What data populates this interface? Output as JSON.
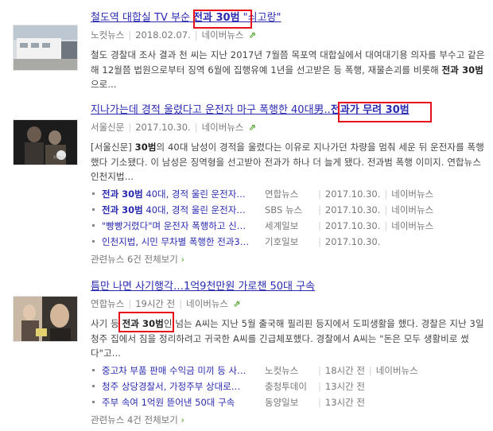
{
  "results": [
    {
      "title_pre": "철도역 대합실 TV 부순 ",
      "title_hl": "전과 30범",
      "title_post": " \"쇠고랑\"",
      "source": "노컷뉴스",
      "date": "2018.02.07.",
      "portal": "네이버뉴스",
      "desc_pre": "철도 경찰대 조사 결과 천 씨는 지난 2017년 7월쯤 목포역 대합실에서 대여대기용 의자를 부수고 같은 해 12월쯤 법원으로부터 징역 6월에 집행유예 1년을 선고받은 등 폭행, 재물손괴를 비롯해 ",
      "desc_bold": "전과 30범",
      "desc_post": "으로..."
    },
    {
      "title_pre": "지나가는데 경적 울렸다고 운전자 마구 폭행한 40대男..",
      "title_hl": "전과가 무려 30범",
      "title_post": "",
      "source": "서울신문",
      "date": "2017.10.30.",
      "portal": "네이버뉴스",
      "desc_pre": "[서울신문] ",
      "desc_bold": "30범",
      "desc_post": "의 40대 남성이 경적을 울렸다는 이유로 지나가던 차량을 멈춰 세운 뒤 운전자를 폭행했다 기소됐다. 이 남성은 징역형을 선고받아 전과가 하나 더 늘게 됐다. 전과범 폭행 이미지. 연합뉴스인천지법...",
      "related": [
        {
          "bold": "전과 30범",
          "rest": " 40대, 경적 울린 운전자…",
          "source": "연합뉴스",
          "date": "2017.10.30.",
          "portal": "네이버뉴스"
        },
        {
          "bold": "전과 30범",
          "rest": " 40대, 경적 울린 운전자…",
          "source": "SBS 뉴스",
          "date": "2017.10.30.",
          "portal": "네이버뉴스"
        },
        {
          "bold": "",
          "rest": "\"빵빵거렸다\"며 운전자 폭행하고 신…",
          "source": "세계일보",
          "date": "2017.10.30.",
          "portal": "네이버뉴스"
        },
        {
          "bold": "",
          "rest": "인천지법, 시민 무차별 폭행한 전과3…",
          "source": "기호일보",
          "date": "2017.10.30.",
          "portal": ""
        }
      ],
      "more": "관련뉴스 6건 전체보기"
    },
    {
      "title_pre": "틈만 나면 사기행각…1억9천만원 가로챈 50대 구속",
      "title_hl": "",
      "title_post": "",
      "source": "연합뉴스",
      "date": "19시간 전",
      "portal": "네이버뉴스",
      "desc_pre": "사기 등 ",
      "desc_bold": "전과 30범",
      "desc_post": "인 넘는 A씨는 지난 5월 출국해 필리핀 등지에서 도피생활을 했다. 경찰은 지난 3일 청주 집에서 짐을 정리하려고 귀국한 A씨를 긴급체포했다. 경찰에서 A씨는 \"돈은 모두 생활비로 썼다\"고...",
      "related": [
        {
          "bold": "",
          "rest": "중고차 부품 판매 수익금 미끼 등 사…",
          "source": "노컷뉴스",
          "date": "18시간 전",
          "portal": "네이버뉴스"
        },
        {
          "bold": "",
          "rest": "청주 상당경찰서, 가정주부 상대로…",
          "source": "충청투데이",
          "date": "13시간 전",
          "portal": ""
        },
        {
          "bold": "",
          "rest": "주부 속여 1억원 뜯어낸 50대 구속",
          "source": "동양일보",
          "date": "13시간 전",
          "portal": ""
        }
      ],
      "more": "관련뉴스 4건 전체보기"
    }
  ],
  "icons": {
    "link": "external-link-icon",
    "arrow": "chevron-right-icon"
  },
  "colors": {
    "link": "#2a2ab0",
    "highlight_box": "#e8101a",
    "naver_green": "#55a630"
  }
}
